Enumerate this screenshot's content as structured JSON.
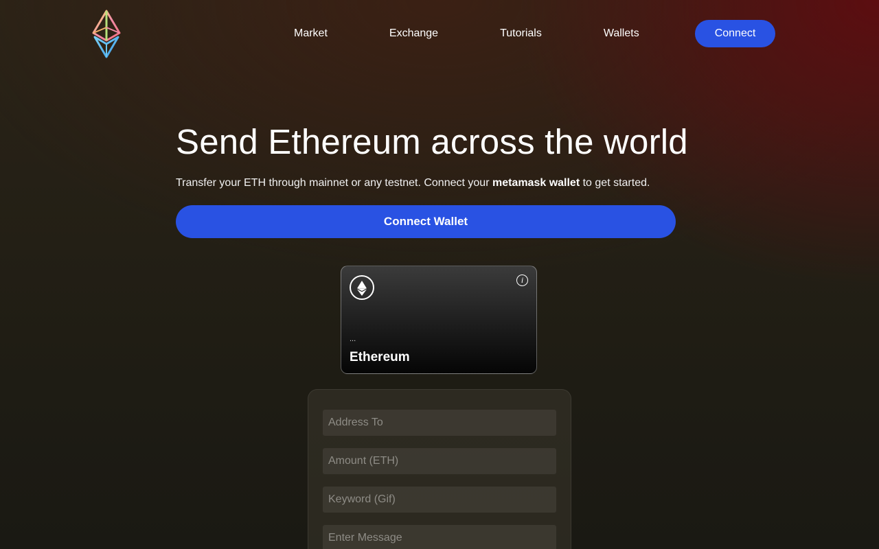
{
  "nav": {
    "links": [
      "Market",
      "Exchange",
      "Tutorials",
      "Wallets"
    ],
    "connect_label": "Connect"
  },
  "hero": {
    "title": "Send Ethereum across the world",
    "subtitle_before": "Transfer your ETH through mainnet or any testnet. Connect your ",
    "subtitle_bold": "metamask wallet",
    "subtitle_after": " to get started.",
    "connect_wallet_label": "Connect Wallet"
  },
  "card": {
    "address": "...",
    "network": "Ethereum",
    "info_glyph": "i"
  },
  "form": {
    "address_placeholder": "Address To",
    "amount_placeholder": "Amount (ETH)",
    "keyword_placeholder": "Keyword (Gif)",
    "message_placeholder": "Enter Message"
  },
  "colors": {
    "accent": "#2952e3",
    "background": "#1b1a13",
    "background_red": "#5f0c10"
  },
  "icons": {
    "logo": "ethereum-logo-icon",
    "card": "ethereum-icon",
    "info": "info-icon"
  }
}
